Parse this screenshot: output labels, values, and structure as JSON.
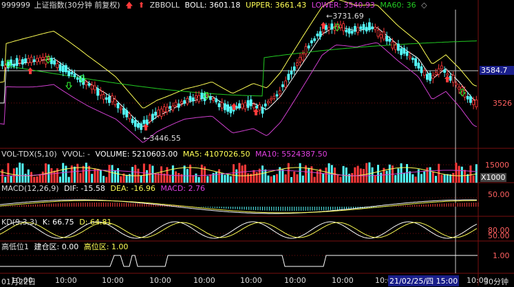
{
  "main": {
    "code": "999999",
    "name": "上证指数(30分钟 前复权)",
    "indicator": "ZBBOLL",
    "boll_label": "BOLL: 3601.18",
    "upper_label": "UPPER: 3661.43",
    "lower_label": "LOWER: 3540.93",
    "ma60_label": "MA60: 36",
    "high_mark": "3731.69",
    "low_mark": "3446.55",
    "price_tag": "3584.7",
    "price_tick": "3526"
  },
  "vol": {
    "title": "VOL-TDX(5,10)",
    "vvol": "VVOL: -",
    "volume": "VOLUME: 5210603.00",
    "ma5": "MA5: 4107026.50",
    "ma10": "MA10: 5524387.50",
    "tick": "15000",
    "unit": "X1000"
  },
  "macd": {
    "title": "MACD(12,26,9)",
    "dif": "DIF: -15.58",
    "dea": "DEA: -16.96",
    "macd": "MACD: 2.76",
    "tick": "50.00"
  },
  "kd": {
    "title": "KD(9,3,3)",
    "k": "K: 66.75",
    "d": "D: 64.81",
    "tick1": "80.00",
    "tick2": "50.00"
  },
  "hl": {
    "title": "高低位1",
    "build": "建仓区: 0.00",
    "high": "高位区: 1.00",
    "tick": "1.00"
  },
  "time_axis": {
    "labels": [
      "01月22日",
      "10:00",
      "10:00",
      "10:00",
      "10:00",
      "10:00",
      "10:00",
      "10:00",
      "10:00",
      "10:00",
      "10:00",
      "10:00"
    ],
    "cursor_label": "21/02/25/四 15:00",
    "period": "30分钟"
  },
  "colors": {
    "up": "#ff3a3a",
    "down": "#54fcfc",
    "mid": "#ffffff",
    "ma60": "#22cc22",
    "lower": "#d040d0",
    "yellow": "#ffff55"
  }
}
